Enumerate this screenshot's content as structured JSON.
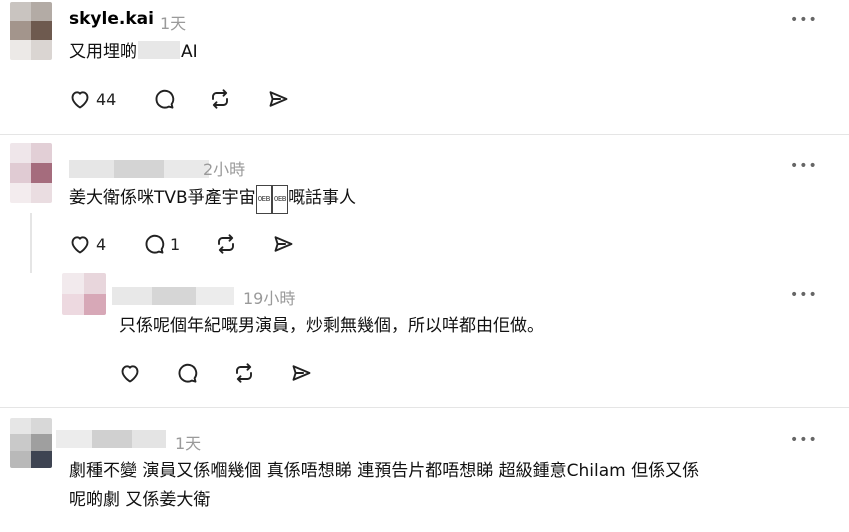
{
  "posts": [
    {
      "username": "skyle.kai",
      "time": "1天",
      "text_before": "又用埋啲",
      "text_after": "AI",
      "likes": "44",
      "more": "•••"
    },
    {
      "username": "",
      "time": "2小時",
      "text_before": "姜大衛係咪TVB爭產宇宙",
      "box_chars": [
        "0EB",
        "0EB"
      ],
      "text_after": "嘅話事人",
      "likes": "4",
      "replies": "1",
      "more": "•••"
    },
    {
      "username": "",
      "time": "19小時",
      "text": "只係呢個年紀嘅男演員，炒剩無幾個，所以咩都由佢做。",
      "more": "•••"
    },
    {
      "username": "",
      "time": "1天",
      "line1": "劇種不變 演員又係嗰幾個 真係唔想睇 連預告片都唔想睇 超級鍾意Chilam 但係又係",
      "line2": "呢啲劇 又係姜大衛",
      "more": "•••"
    }
  ],
  "icons": {
    "like": "heart-icon",
    "reply": "comment-icon",
    "repost": "repost-icon",
    "share": "share-icon",
    "more": "more-options-icon"
  },
  "colors": {
    "text": "#000000",
    "muted": "#9a9a9a",
    "divider": "#e5e5e5",
    "icon": "#222222"
  }
}
